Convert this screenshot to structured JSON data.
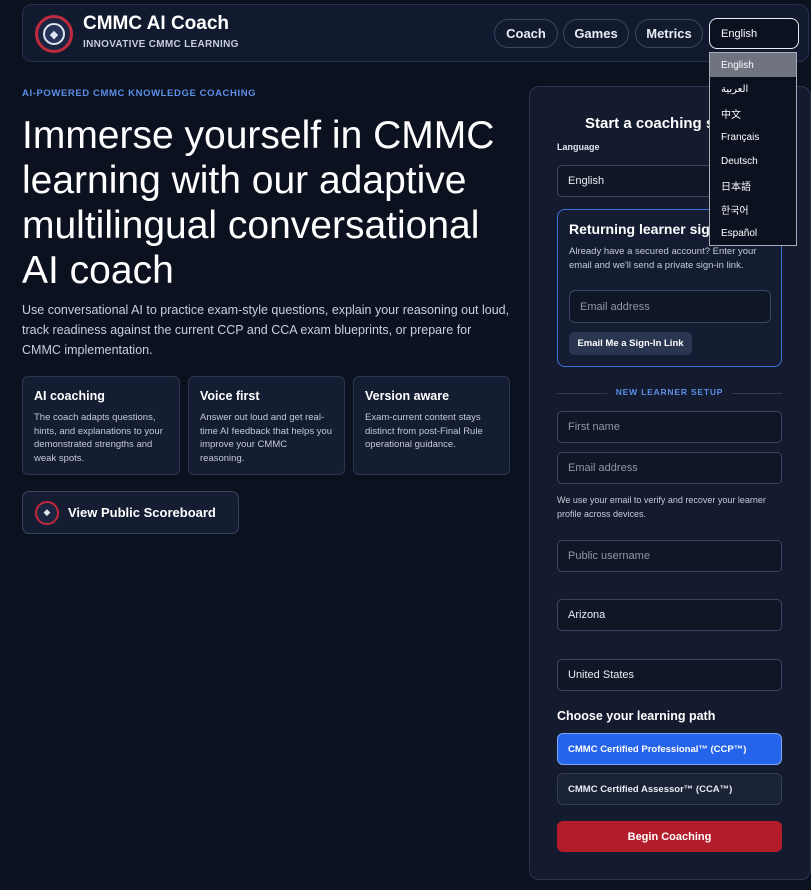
{
  "header": {
    "title": "CMMC AI Coach",
    "subtitle": "INNOVATIVE CMMC LEARNING",
    "nav": [
      "Coach",
      "Games",
      "Metrics"
    ],
    "language_selected": "English"
  },
  "hero": {
    "eyebrow": "AI-POWERED CMMC KNOWLEDGE COACHING",
    "headline": "Immerse yourself in CMMC learning with our adaptive multilingual conversational AI coach",
    "lead": "Use conversational AI to practice exam-style questions, explain your reasoning out loud, track readiness against the current CCP and CCA exam blueprints, or prepare for CMMC implementation."
  },
  "features": [
    {
      "title": "AI coaching",
      "text": "The coach adapts questions, hints, and explanations to your demonstrated strengths and weak spots."
    },
    {
      "title": "Voice first",
      "text": "Answer out loud and get real-time AI feedback that helps you improve your CMMC reasoning."
    },
    {
      "title": "Version aware",
      "text": "Exam-current content stays distinct from post-Final Rule operational guidance."
    }
  ],
  "scoreboard_label": "View Public Scoreboard",
  "panel": {
    "title": "Start a coaching s",
    "language_label": "Language",
    "language_value": "English",
    "returning": {
      "title": "Returning learner sig",
      "text": "Already have a secured account? Enter your email and we'll send a private sign-in link.",
      "email_placeholder": "Email address",
      "button": "Email Me a Sign-In Link"
    },
    "divider": "NEW LEARNER SETUP",
    "first_name_placeholder": "First name",
    "email_placeholder": "Email address",
    "email_note": "We use your email to verify and recover your learner profile across devices.",
    "username_placeholder": "Public username",
    "state_value": "Arizona",
    "country_value": "United States",
    "path_title": "Choose your learning path",
    "path_options": [
      "CMMC Certified Professional™ (CCP™)",
      "CMMC Certified Assessor™ (CCA™)"
    ],
    "begin_button": "Begin Coaching"
  },
  "language_dropdown": [
    "English",
    "العربية",
    "中文",
    "Français",
    "Deutsch",
    "日本語",
    "한국어",
    "Español"
  ],
  "colors": {
    "accent": "#2563eb",
    "brand_red": "#b31c2b",
    "background": "#0c1120"
  }
}
